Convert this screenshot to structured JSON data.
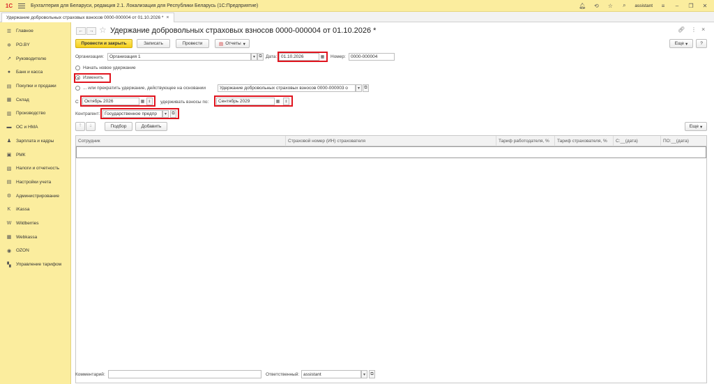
{
  "titlebar": {
    "logo": "1С",
    "app_title": "Бухгалтерия для Беларуси, редакция 2.1. Локализация для Республики Беларусь   (1С:Предприятие)",
    "user": "assistant"
  },
  "tab": {
    "label": "Удержание добровольных страховых взносов 0000-000004 от 01.10.2026 *",
    "close": "×"
  },
  "sidebar": {
    "items": [
      {
        "label": "Главное",
        "icon": "☰"
      },
      {
        "label": "РО.BY",
        "icon": "✲"
      },
      {
        "label": "Руководителю",
        "icon": "↗"
      },
      {
        "label": "Банк и касса",
        "icon": "●"
      },
      {
        "label": "Покупки и продажи",
        "icon": "▤"
      },
      {
        "label": "Склад",
        "icon": "▦"
      },
      {
        "label": "Производство",
        "icon": "▥"
      },
      {
        "label": "ОС и НМА",
        "icon": "▬"
      },
      {
        "label": "Зарплата и кадры",
        "icon": "♟"
      },
      {
        "label": "РМК",
        "icon": "▣"
      },
      {
        "label": "Налоги и отчетность",
        "icon": "▧"
      },
      {
        "label": "Настройки учета",
        "icon": "▤"
      },
      {
        "label": "Администрирование",
        "icon": "⚙"
      },
      {
        "label": "iKassa",
        "icon": "K"
      },
      {
        "label": "Wildberries",
        "icon": "W"
      },
      {
        "label": "Webkassa",
        "icon": "▦"
      },
      {
        "label": "OZON",
        "icon": "◉"
      },
      {
        "label": "Управление тарифом",
        "icon": "▚"
      }
    ]
  },
  "document": {
    "title": "Удержание добровольных страховых взносов 0000-000004 от 01.10.2026 *",
    "toolbar": {
      "post_close": "Провести и закрыть",
      "save": "Записать",
      "post": "Провести",
      "reports": "Отчеты",
      "more": "Еще",
      "help": "?"
    },
    "org_label": "Организация:",
    "org_value": "Организация 1",
    "date_label": "Дата:",
    "date_value": "01.10.2026",
    "number_label": "Номер:",
    "number_value": "0000-000004",
    "radio_new": "Начать новое удержание",
    "radio_change": "Изменить",
    "radio_stop": "... или прекратить удержание, действующее на основании",
    "basis_value": "Удержание добровольных страховых взносов 0000-000003 о",
    "from_label": "С",
    "from_value": "Октябрь 2026",
    "until_label": "удерживать взносы по:",
    "until_value": "Сентябрь 2029",
    "counterparty_label": "Контрагент:",
    "counterparty_value": "Государственное предпр",
    "table_toolbar": {
      "select": "Подбор",
      "add": "Добавить",
      "more": "Еще"
    },
    "columns": [
      "Сотрудник",
      "Страховой номер (ИН) страхователя",
      "Тариф работодателя, %",
      "Тариф страхователя, %",
      "С:__(дата)",
      "ПО:__(дата)"
    ],
    "comment_label": "Комментарий:",
    "comment_value": "",
    "responsible_label": "Ответственный:",
    "responsible_value": "assistant"
  },
  "colors": {
    "accent": "#fbed9e",
    "primary_button": "#f5cf1c",
    "highlight": "#e0141e"
  }
}
